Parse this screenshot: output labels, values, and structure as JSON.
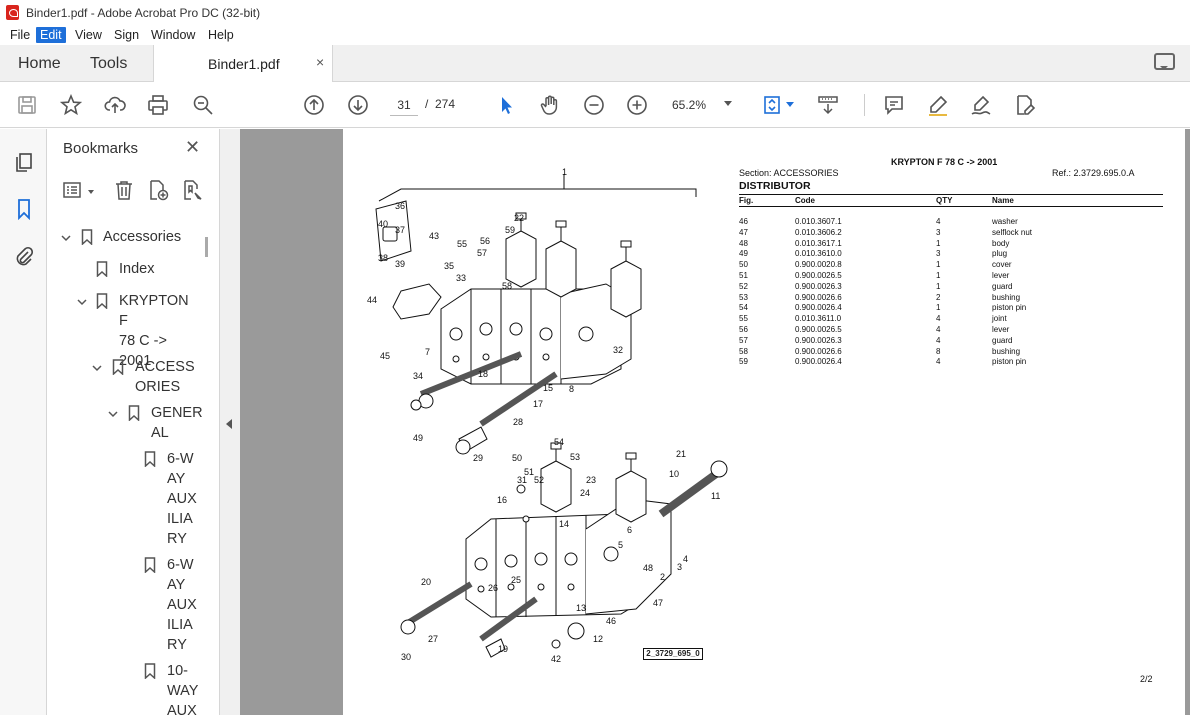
{
  "window": {
    "title": "Binder1.pdf - Adobe Acrobat Pro DC (32-bit)"
  },
  "menu": [
    "File",
    "Edit",
    "View",
    "Sign",
    "Window",
    "Help"
  ],
  "menu_active": "Edit",
  "tabs": {
    "home": "Home",
    "tools": "Tools",
    "document": "Binder1.pdf",
    "close": "×"
  },
  "toolbar": {
    "page_current": "31",
    "page_sep": "/",
    "page_total": "274",
    "zoom": "65.2%"
  },
  "bookmarks": {
    "title": "Bookmarks",
    "items": [
      {
        "label": "Accessories",
        "level": 0,
        "expanded": true
      },
      {
        "label": "Index",
        "level": 1,
        "expanded": null
      },
      {
        "label": "KRYPTON F 78 C -> 2001",
        "level": 1,
        "expanded": true
      },
      {
        "label": "ACCESSORIES",
        "level": 2,
        "expanded": true
      },
      {
        "label": "GENERAL",
        "level": 3,
        "expanded": true
      },
      {
        "label": "6-WAY AUXILIARY",
        "level": 4,
        "expanded": null
      },
      {
        "label": "6-WAY AUXILIARY",
        "level": 4,
        "expanded": null
      },
      {
        "label": "10-WAY AUX",
        "level": 4,
        "expanded": null
      }
    ],
    "display": [
      "Accessories",
      "Index",
      [
        "KRYPTON F",
        "78 C ->",
        "2001"
      ],
      [
        "ACCESS",
        "ORIES"
      ],
      [
        "GENER",
        "AL"
      ],
      [
        "6-W",
        "AY",
        "AUX",
        "ILIA",
        "RY"
      ],
      [
        "6-W",
        "AY",
        "AUX",
        "ILIA",
        "RY"
      ],
      [
        "10-",
        "WAY",
        "AUX"
      ]
    ]
  },
  "document": {
    "model": "KRYPTON F 78 C -> 2001",
    "section": "Section: ACCESSORIES",
    "ref": "Ref.: 2.3729.695.0.A",
    "title": "DISTRIBUTOR",
    "columns": [
      "Fig.",
      "Code",
      "QTY",
      "Name"
    ],
    "rows": [
      [
        "46",
        "0.010.3607.1",
        "4",
        "washer"
      ],
      [
        "47",
        "0.010.3606.2",
        "3",
        "selflock nut"
      ],
      [
        "48",
        "0.010.3617.1",
        "1",
        "body"
      ],
      [
        "49",
        "0.010.3610.0",
        "3",
        "plug"
      ],
      [
        "50",
        "0.900.0020.8",
        "1",
        "cover"
      ],
      [
        "51",
        "0.900.0026.5",
        "1",
        "lever"
      ],
      [
        "52",
        "0.900.0026.3",
        "1",
        "guard"
      ],
      [
        "53",
        "0.900.0026.6",
        "2",
        "bushing"
      ],
      [
        "54",
        "0.900.0026.4",
        "1",
        "piston pin"
      ],
      [
        "55",
        "0.010.3611.0",
        "4",
        "joint"
      ],
      [
        "56",
        "0.900.0026.5",
        "4",
        "lever"
      ],
      [
        "57",
        "0.900.0026.3",
        "4",
        "guard"
      ],
      [
        "58",
        "0.900.0026.6",
        "8",
        "bushing"
      ],
      [
        "59",
        "0.900.0026.4",
        "4",
        "piston pin"
      ]
    ],
    "figure_label": "2_3729_695_0",
    "page_number": "2/2",
    "callouts": [
      "1",
      "36",
      "40",
      "37",
      "38",
      "39",
      "43",
      "35",
      "33",
      "55",
      "56",
      "57",
      "22",
      "59",
      "58",
      "44",
      "45",
      "34",
      "7",
      "32",
      "18",
      "15",
      "17",
      "8",
      "28",
      "29",
      "49",
      "50",
      "51",
      "52",
      "54",
      "53",
      "23",
      "24",
      "31",
      "16",
      "14",
      "21",
      "10",
      "11",
      "6",
      "5",
      "4",
      "3",
      "2",
      "48",
      "47",
      "46",
      "12",
      "13",
      "42",
      "19",
      "20",
      "27",
      "30",
      "26",
      "25"
    ]
  }
}
